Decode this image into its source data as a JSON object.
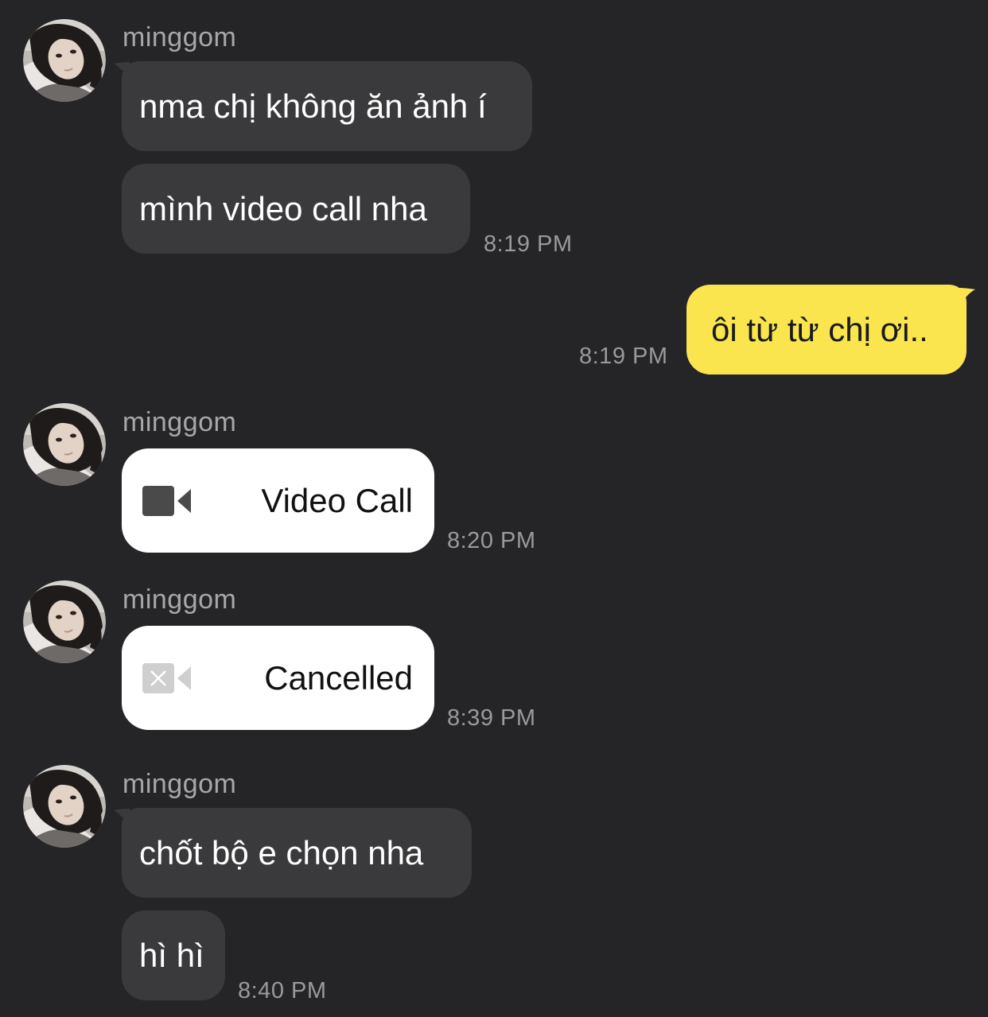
{
  "colors": {
    "background": "#252527",
    "incoming_bubble": "#3a3a3c",
    "outgoing_bubble": "#fae54f",
    "call_card": "#ffffff",
    "timestamp": "#9a9a9c",
    "sender_name": "#a8a8aa"
  },
  "groups": [
    {
      "sender": "minggom",
      "messages": [
        "nma chị không ăn ảnh í",
        "mình video call nha"
      ],
      "time": "8:19 PM"
    },
    {
      "outgoing": true,
      "messages": [
        "ôi từ từ chị ơi.."
      ],
      "time": "8:19 PM"
    },
    {
      "sender": "minggom",
      "call": {
        "label": "Video Call",
        "icon": "video-camera-icon"
      },
      "time": "8:20 PM"
    },
    {
      "sender": "minggom",
      "call": {
        "label": "Cancelled",
        "icon": "video-cancelled-icon"
      },
      "time": "8:39 PM"
    },
    {
      "sender": "minggom",
      "messages": [
        "chốt bộ e chọn nha",
        "hì hì"
      ],
      "time": "8:40 PM"
    }
  ]
}
